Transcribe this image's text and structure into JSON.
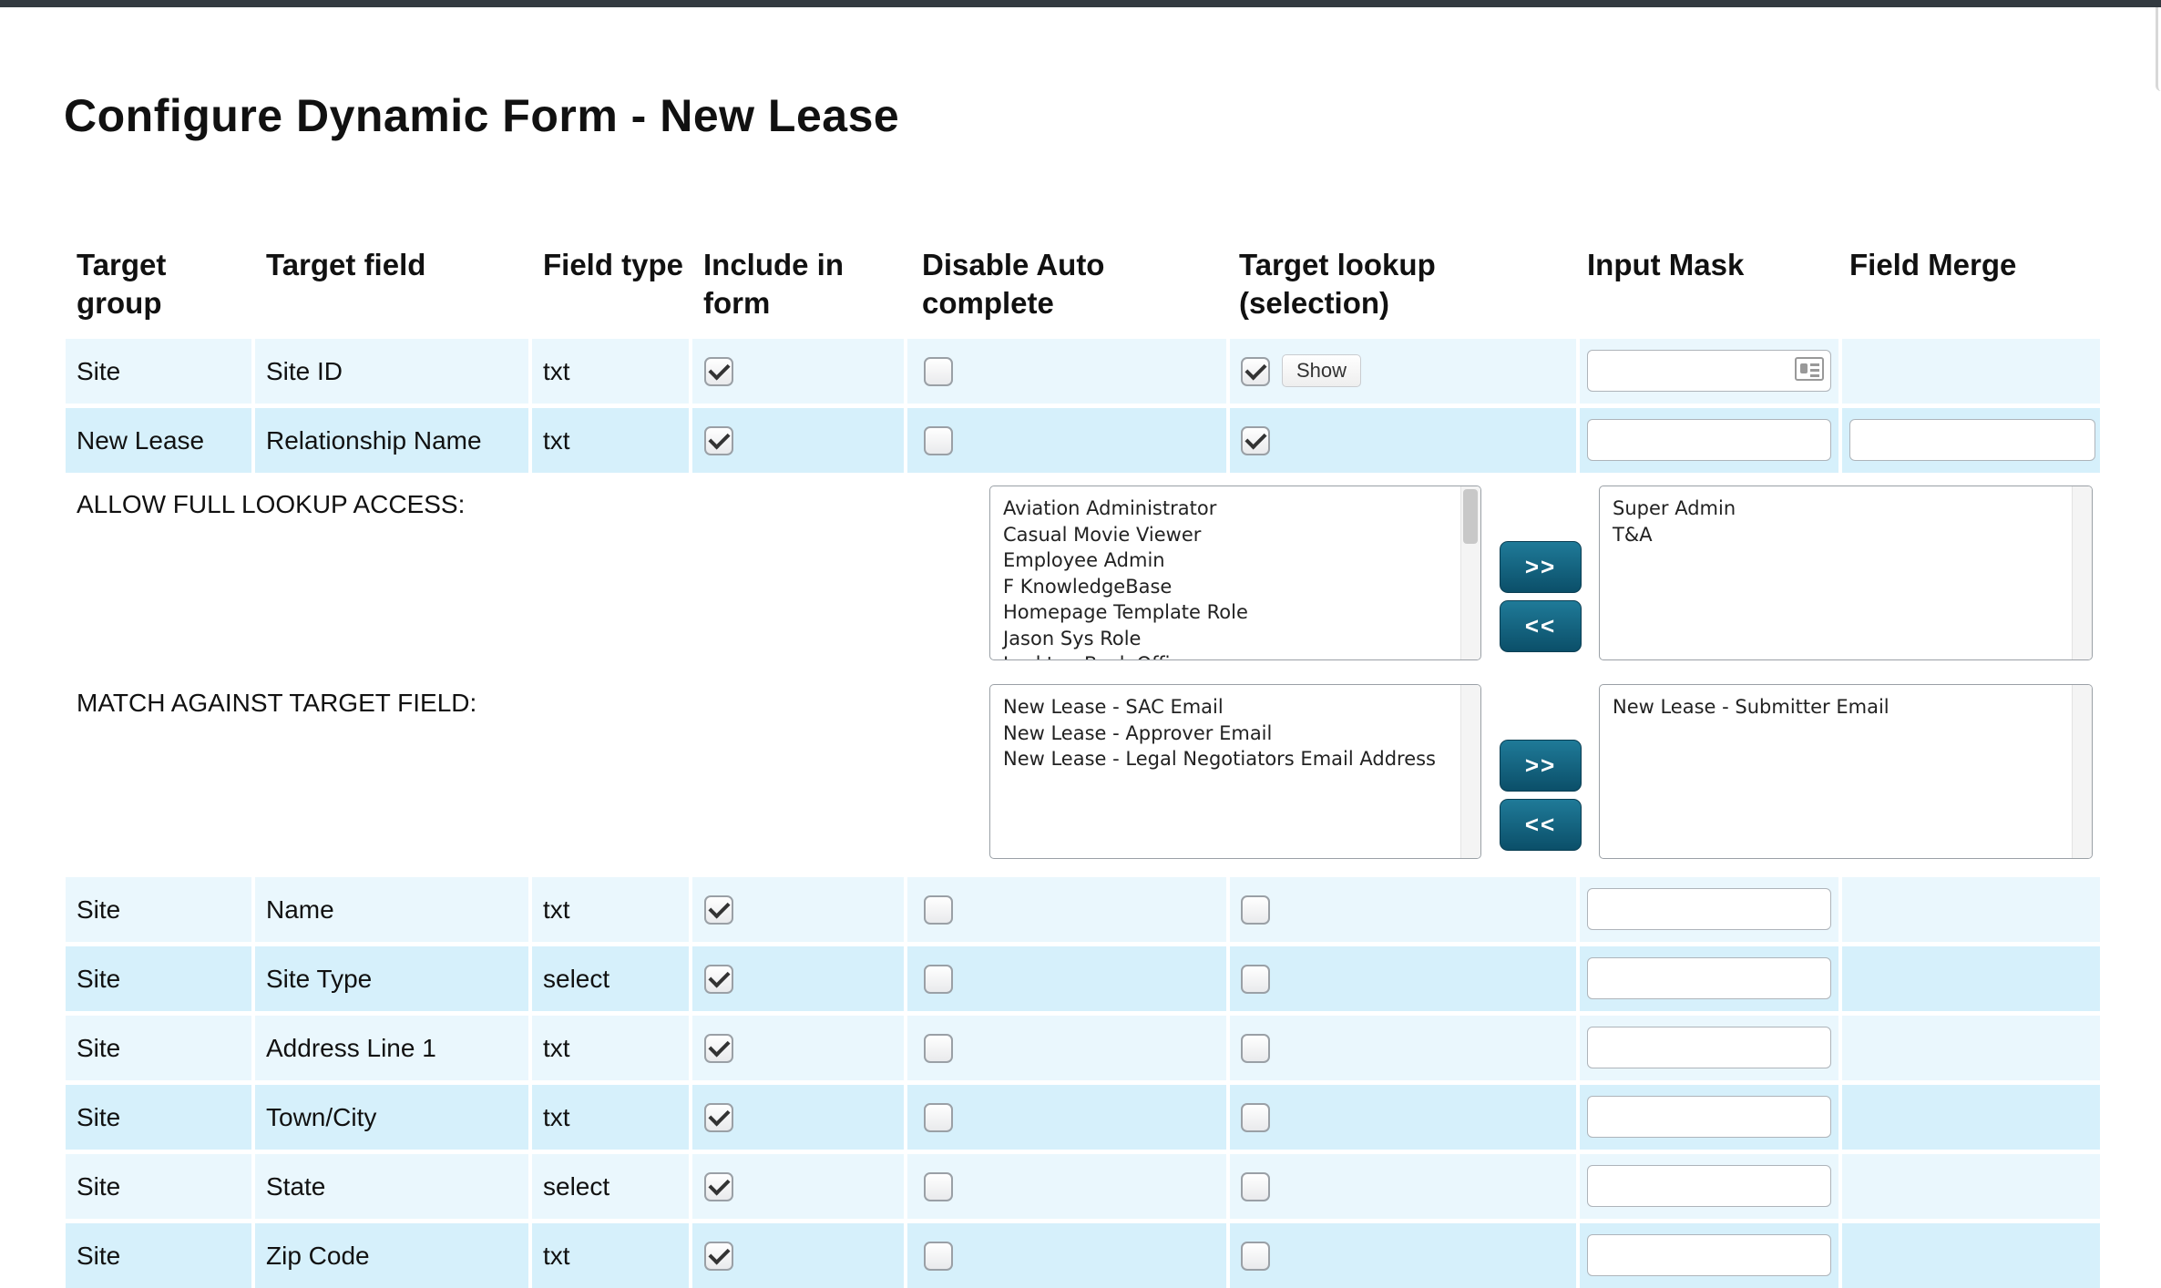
{
  "page": {
    "title": "Configure Dynamic Form - New Lease"
  },
  "table": {
    "headers": {
      "target_group": [
        "Target",
        "group"
      ],
      "target_field": [
        "Target field"
      ],
      "field_type": [
        "Field type"
      ],
      "include": [
        "Include in",
        "form"
      ],
      "disable_auto": [
        "Disable Auto",
        "complete"
      ],
      "target_lookup": [
        "Target lookup",
        "(selection)"
      ],
      "input_mask": [
        "Input Mask"
      ],
      "field_merge": [
        "Field Merge"
      ]
    },
    "top_rows": [
      {
        "group": "Site",
        "field": "Site ID",
        "type": "txt",
        "include": true,
        "disable_auto": false,
        "lookup": true,
        "show_label": "Show",
        "has_merge": false
      },
      {
        "group": "New Lease",
        "field": "Relationship Name",
        "type": "txt",
        "include": true,
        "disable_auto": false,
        "lookup": true,
        "has_merge": true
      }
    ],
    "bottom_rows": [
      {
        "group": "Site",
        "field": "Name",
        "type": "txt",
        "include": true,
        "disable_auto": false,
        "lookup": false
      },
      {
        "group": "Site",
        "field": "Site Type",
        "type": "select",
        "include": true,
        "disable_auto": false,
        "lookup": false
      },
      {
        "group": "Site",
        "field": "Address Line 1",
        "type": "txt",
        "include": true,
        "disable_auto": false,
        "lookup": false
      },
      {
        "group": "Site",
        "field": "Town/City",
        "type": "txt",
        "include": true,
        "disable_auto": false,
        "lookup": false
      },
      {
        "group": "Site",
        "field": "State",
        "type": "select",
        "include": true,
        "disable_auto": false,
        "lookup": false
      },
      {
        "group": "Site",
        "field": "Zip Code",
        "type": "txt",
        "include": true,
        "disable_auto": false,
        "lookup": false
      }
    ]
  },
  "lookup_access": {
    "label": "ALLOW FULL LOOKUP ACCESS:",
    "available": [
      "Aviation Administrator",
      "Casual Movie Viewer",
      "Employee Admin",
      "F KnowledgeBase",
      "Homepage Template Role",
      "Jason Sys Role",
      "Lockton Back Office"
    ],
    "selected": [
      "Super Admin",
      "T&A"
    ],
    "add_label": ">>",
    "remove_label": "<<"
  },
  "match_target": {
    "label": "MATCH AGAINST TARGET FIELD:",
    "available": [
      "New Lease - SAC Email",
      "New Lease - Approver Email",
      "New Lease - Legal Negotiators Email Address"
    ],
    "selected": [
      "New Lease - Submitter Email"
    ],
    "add_label": ">>",
    "remove_label": "<<"
  },
  "colors": {
    "row_light": "#eaf7fd",
    "row_dark": "#d6f0fb",
    "button": "#0b5d7a",
    "topbar": "#333a40"
  },
  "icons": {
    "input_mask": "address-card-icon",
    "checkbox_checked": "checkmark-icon"
  }
}
